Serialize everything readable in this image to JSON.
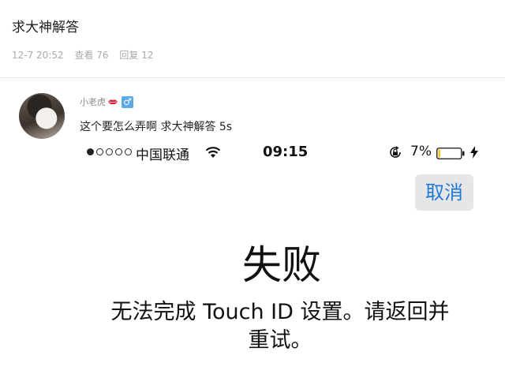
{
  "post": {
    "title": "求大神解答",
    "datetime": "12-7 20:52",
    "views": "查看 76",
    "replies": "回复 12"
  },
  "reply": {
    "username": "小老虎",
    "gender_icon": "male-icon",
    "badge_icon": "lips-icon",
    "text": "这个要怎么弄啊 求大神解答 5s"
  },
  "phone": {
    "signal_dots_filled": 1,
    "signal_dots_total": 5,
    "carrier": "中国联通",
    "time": "09:15",
    "battery_percent": "7%",
    "battery_level": 0.07,
    "cancel_label": "取消",
    "fail_title": "失败",
    "fail_message": "无法完成 Touch ID 设置。请返回并重试。"
  },
  "colors": {
    "accent_blue": "#1f7bd6",
    "male_badge": "#5aa9e6",
    "lips_red": "#d81e3c",
    "battery_low": "#f5c518"
  }
}
